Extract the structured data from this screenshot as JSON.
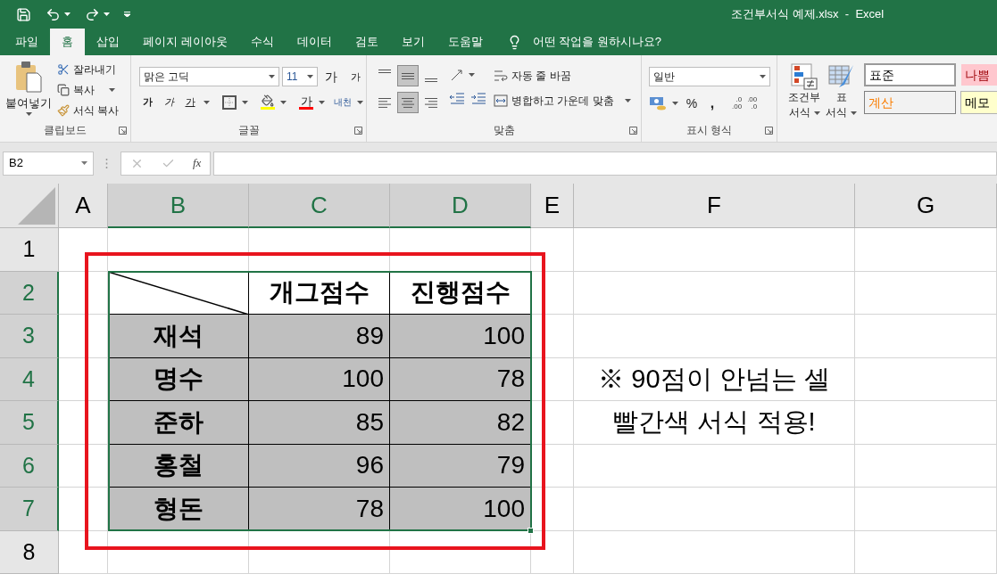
{
  "title_bar": {
    "title": "조건부서식 예제.xlsx  -  Excel"
  },
  "ribbon_tabs": [
    {
      "label": "파일",
      "selected": false
    },
    {
      "label": "홈",
      "selected": true
    },
    {
      "label": "삽입",
      "selected": false
    },
    {
      "label": "페이지 레이아웃",
      "selected": false
    },
    {
      "label": "수식",
      "selected": false
    },
    {
      "label": "데이터",
      "selected": false
    },
    {
      "label": "검토",
      "selected": false
    },
    {
      "label": "보기",
      "selected": false
    },
    {
      "label": "도움말",
      "selected": false
    }
  ],
  "tell_me": {
    "placeholder": "어떤 작업을 원하시나요?"
  },
  "ribbon": {
    "clipboard": {
      "label": "클립보드",
      "paste": "붙여넣기",
      "cut": "잘라내기",
      "copy": "복사",
      "format_painter": "서식 복사"
    },
    "font": {
      "label": "글꼴",
      "font_name": "맑은 고딕",
      "font_size": "11",
      "grow": "가",
      "shrink": "가",
      "bold": "가",
      "italic": "가",
      "underline": "가",
      "font_color": "가",
      "phonetic": "내천"
    },
    "alignment": {
      "label": "맞춤",
      "vertical": [
        {
          "kind": "top",
          "selected": false
        },
        {
          "kind": "middle",
          "selected": true
        },
        {
          "kind": "bottom",
          "selected": false
        }
      ],
      "horizontal": [
        {
          "kind": "left",
          "selected": false
        },
        {
          "kind": "center",
          "selected": true
        },
        {
          "kind": "right",
          "selected": false
        }
      ],
      "wrap_text": "자동 줄 바꿈",
      "merge": "병합하고 가운데 맞춤"
    },
    "number": {
      "label": "표시 형식",
      "format": "일반",
      "percent": "%",
      "comma": ",",
      "increase_decimal": [
        ".0",
        ".00"
      ],
      "decrease_decimal": [
        ".00",
        ".0"
      ]
    },
    "styles": {
      "conditional_formatting": [
        "조건부",
        "서식"
      ],
      "format_as_table": [
        "표",
        "서식"
      ],
      "cell_styles": [
        {
          "label": "표준",
          "kind": "normal"
        },
        {
          "label": "나쁨",
          "kind": "bad"
        },
        {
          "label": "계산",
          "kind": "calculation"
        },
        {
          "label": "메모",
          "kind": "note"
        }
      ]
    }
  },
  "formula_bar": {
    "name_box": "B2",
    "function_label": "fx"
  },
  "sheet": {
    "columns": [
      {
        "label": "A",
        "selected": false
      },
      {
        "label": "B",
        "selected": true
      },
      {
        "label": "C",
        "selected": true
      },
      {
        "label": "D",
        "selected": true
      },
      {
        "label": "E",
        "selected": false
      },
      {
        "label": "F",
        "selected": false
      },
      {
        "label": "G",
        "selected": false
      }
    ],
    "rows": [
      {
        "label": "1",
        "selected": false
      },
      {
        "label": "2",
        "selected": true
      },
      {
        "label": "3",
        "selected": true
      },
      {
        "label": "4",
        "selected": true
      },
      {
        "label": "5",
        "selected": true
      },
      {
        "label": "6",
        "selected": true
      },
      {
        "label": "7",
        "selected": true
      },
      {
        "label": "8",
        "selected": false
      }
    ],
    "score_table": {
      "headers": [
        "개그점수",
        "진행점수"
      ],
      "rows": [
        {
          "name": "재석",
          "values": [
            "89",
            "100"
          ]
        },
        {
          "name": "명수",
          "values": [
            "100",
            "78"
          ]
        },
        {
          "name": "준하",
          "values": [
            "85",
            "82"
          ]
        },
        {
          "name": "홍철",
          "values": [
            "96",
            "79"
          ]
        },
        {
          "name": "형돈",
          "values": [
            "78",
            "100"
          ]
        }
      ]
    },
    "note": [
      "※ 90점이 안넘는 셀",
      "빨간색 서식 적용!"
    ]
  }
}
